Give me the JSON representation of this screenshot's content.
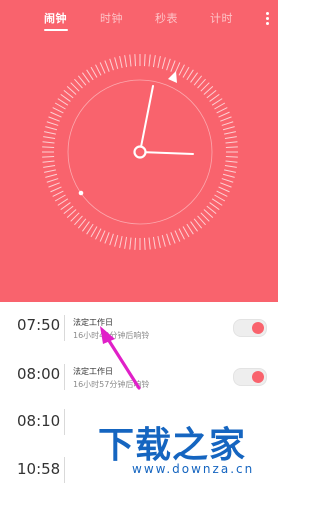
{
  "tabs": [
    {
      "label": "闹钟",
      "active": true
    },
    {
      "label": "时钟",
      "active": false
    },
    {
      "label": "秒表",
      "active": false
    },
    {
      "label": "计时",
      "active": false
    }
  ],
  "menu_icon": "more-vertical-icon",
  "colors": {
    "accent": "#f9636d",
    "text": "#333333",
    "subtext": "#8a8a8a",
    "watermark": "#1565c0",
    "arrow": "#e020c8"
  },
  "alarms": [
    {
      "time": "07:50",
      "label": "法定工作日",
      "sub": "16小时40分钟后响铃",
      "enabled": true
    },
    {
      "time": "08:00",
      "label": "法定工作日",
      "sub": "16小时57分钟后响铃",
      "enabled": true
    },
    {
      "time": "08:10",
      "label": "",
      "sub": "",
      "enabled": false
    },
    {
      "time": "10:58",
      "label": "",
      "sub": "",
      "enabled": false
    }
  ],
  "watermark": {
    "title": "下载之家",
    "url": "www.downza.cn"
  }
}
